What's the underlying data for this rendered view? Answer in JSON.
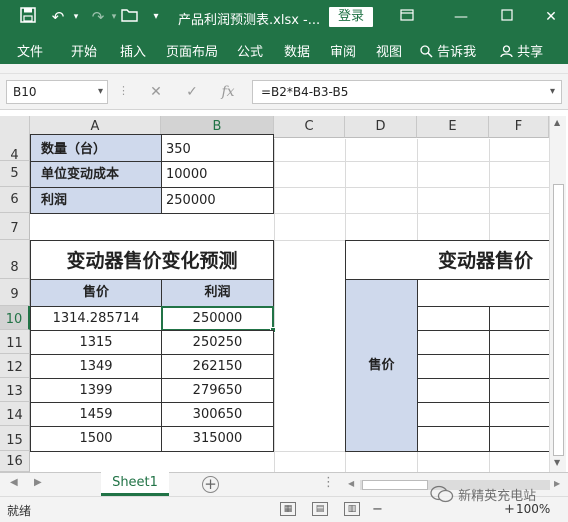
{
  "titlebar": {
    "doc_title": "产品利润预测表.xlsx  -...",
    "login": "登录",
    "icons": [
      "save-icon",
      "undo-icon",
      "redo-icon",
      "open-folder-icon",
      "customize-quick-access-icon",
      "ribbon-display-icon",
      "minimize-icon",
      "maximize-icon"
    ]
  },
  "ribbon": {
    "tabs": [
      "文件",
      "开始",
      "插入",
      "页面布局",
      "公式",
      "数据",
      "审阅",
      "视图",
      "告诉我",
      "共享"
    ]
  },
  "formula_bar": {
    "name_box": "B10",
    "formula": "=B2*B4-B3-B5"
  },
  "grid": {
    "columns": [
      "A",
      "B",
      "C",
      "D",
      "E",
      "F"
    ],
    "selected_column": "B",
    "rows": [
      "4",
      "5",
      "6",
      "7",
      "8",
      "9",
      "10",
      "11",
      "12",
      "13",
      "14",
      "15",
      "16"
    ],
    "selected_row": "10",
    "inputs": [
      {
        "label": "数量（台）",
        "value": "350"
      },
      {
        "label": "单位变动成本",
        "value": "10000"
      },
      {
        "label": " 利润",
        "value": "250000"
      }
    ],
    "table1": {
      "title": "变动器售价变化预测",
      "headers": [
        "售价",
        "利润"
      ],
      "rows": [
        [
          "1314.285714",
          "250000"
        ],
        [
          "1315",
          "250250"
        ],
        [
          "1349",
          "262150"
        ],
        [
          "1399",
          "279650"
        ],
        [
          "1459",
          "300650"
        ],
        [
          "1500",
          "315000"
        ]
      ]
    },
    "table2": {
      "title": "变动器售价",
      "side_label": "售价"
    }
  },
  "sheets": {
    "tabs": [
      "Sheet1"
    ],
    "active": "Sheet1"
  },
  "status": {
    "text": "就绪",
    "zoom": "100%"
  },
  "watermark": "新精英充电站",
  "colors": {
    "excel_green": "#217346",
    "label_fill": "#cfd9ec"
  }
}
